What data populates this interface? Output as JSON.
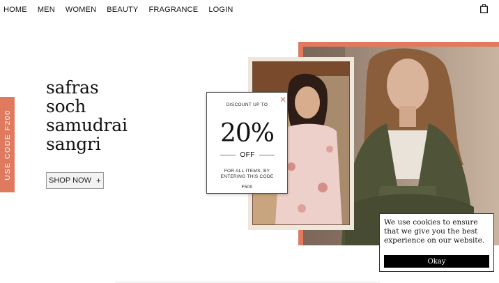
{
  "nav": {
    "items": [
      "HOME",
      "MEN",
      "WOMEN",
      "BEAUTY",
      "FRAGRANCE",
      "LOGIN"
    ],
    "cart_icon": "shopping-bag-icon"
  },
  "hero": {
    "headline": [
      "safras",
      "soch",
      "samudrai",
      "sangri"
    ],
    "shop_button": "SHOP NOW",
    "shop_button_icon": "+"
  },
  "side_tab": {
    "text": "USE CODE F200",
    "color": "#e07a5f"
  },
  "popup": {
    "close": "✕",
    "heading": "DISCOUNT UP TO",
    "percent": "20%",
    "off": "OFF",
    "line1": "FOR ALL ITEMS, BY",
    "line2": "ENTERING THIS CODE",
    "code": "F500"
  },
  "cookie": {
    "message": "We use cookies to ensure that we give you the best experience on our website.",
    "button": "Okay"
  },
  "colors": {
    "accent": "#e07a5f",
    "frame_beige": "#efe6dc"
  }
}
